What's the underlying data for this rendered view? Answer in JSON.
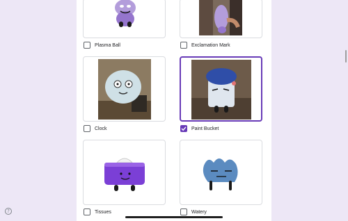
{
  "options": [
    {
      "label": "Plasma Ball",
      "checked": false
    },
    {
      "label": "Exclamation Mark",
      "checked": false
    },
    {
      "label": "Clock",
      "checked": false
    },
    {
      "label": "Paint Bucket",
      "checked": true
    },
    {
      "label": "Tissues",
      "checked": false
    },
    {
      "label": "Watery",
      "checked": false
    }
  ],
  "help_icon": "?",
  "colors": {
    "accent": "#673ab7",
    "page_bg": "#ede7f6"
  }
}
